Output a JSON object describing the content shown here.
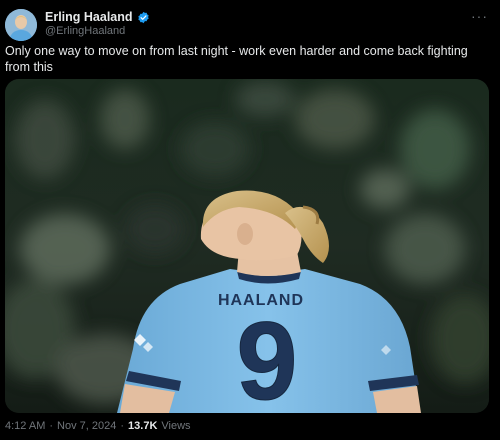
{
  "author": {
    "display_name": "Erling Haaland",
    "handle": "@ErlingHaaland",
    "verified": true
  },
  "tweet": {
    "text": "Only one way to move on from last night - work even harder and come back fighting from this"
  },
  "media": {
    "jersey_name": "HAALAND",
    "jersey_number": "9",
    "jersey_color": "#7bb8e3"
  },
  "meta": {
    "time": "4:12 AM",
    "separator": "·",
    "date": "Nov 7, 2024",
    "views_count": "13.7K",
    "views_label": "Views"
  },
  "colors": {
    "background": "#000000",
    "text_primary": "#e7e9ea",
    "text_secondary": "#71767b",
    "verified_badge": "#1d9bf0"
  },
  "icons": {
    "verified": "verified-badge-icon",
    "more": "more-options-icon"
  }
}
